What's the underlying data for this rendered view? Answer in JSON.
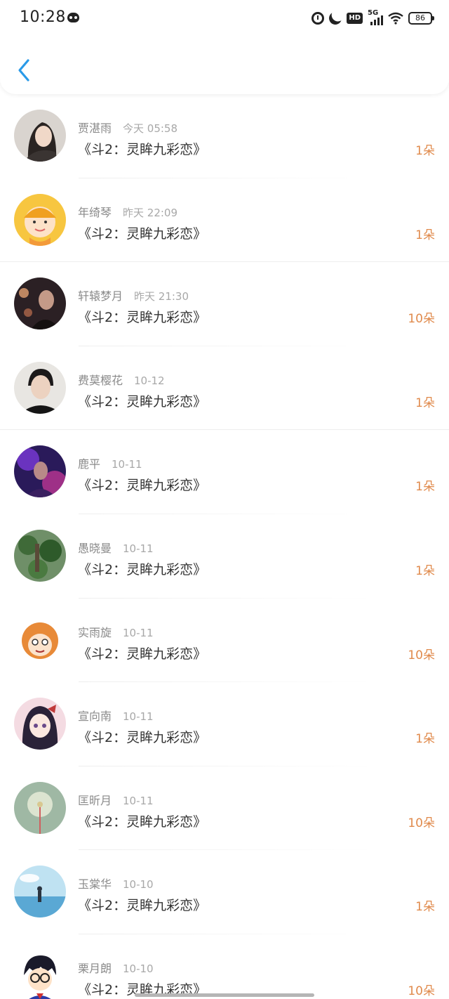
{
  "status_bar": {
    "time": "10:28",
    "network": "5G",
    "hd": "HD",
    "battery": "86"
  },
  "colors": {
    "accent": "#2a9ae8",
    "amount": "#e08a4c"
  },
  "header": {
    "back_icon": "chevron-left-icon"
  },
  "entries": [
    {
      "name": "贾湛雨",
      "date": "今天 05:58",
      "book": "《斗2：灵眸九彩恋》",
      "amount": "1朵"
    },
    {
      "name": "年绮琴",
      "date": "昨天 22:09",
      "book": "《斗2：灵眸九彩恋》",
      "amount": "1朵"
    },
    {
      "name": "轩辕梦月",
      "date": "昨天 21:30",
      "book": "《斗2：灵眸九彩恋》",
      "amount": "10朵"
    },
    {
      "name": "费莫樱花",
      "date": "10-12",
      "book": "《斗2：灵眸九彩恋》",
      "amount": "1朵"
    },
    {
      "name": "鹿平",
      "date": "10-11",
      "book": "《斗2：灵眸九彩恋》",
      "amount": "1朵"
    },
    {
      "name": "愚晓曼",
      "date": "10-11",
      "book": "《斗2：灵眸九彩恋》",
      "amount": "1朵"
    },
    {
      "name": "实雨旋",
      "date": "10-11",
      "book": "《斗2：灵眸九彩恋》",
      "amount": "10朵"
    },
    {
      "name": "宣向南",
      "date": "10-11",
      "book": "《斗2：灵眸九彩恋》",
      "amount": "1朵"
    },
    {
      "name": "匡昕月",
      "date": "10-11",
      "book": "《斗2：灵眸九彩恋》",
      "amount": "10朵"
    },
    {
      "name": "玉棠华",
      "date": "10-10",
      "book": "《斗2：灵眸九彩恋》",
      "amount": "1朵"
    },
    {
      "name": "栗月朗",
      "date": "10-10",
      "book": "《斗2：灵眸九彩恋》",
      "amount": "10朵"
    }
  ]
}
